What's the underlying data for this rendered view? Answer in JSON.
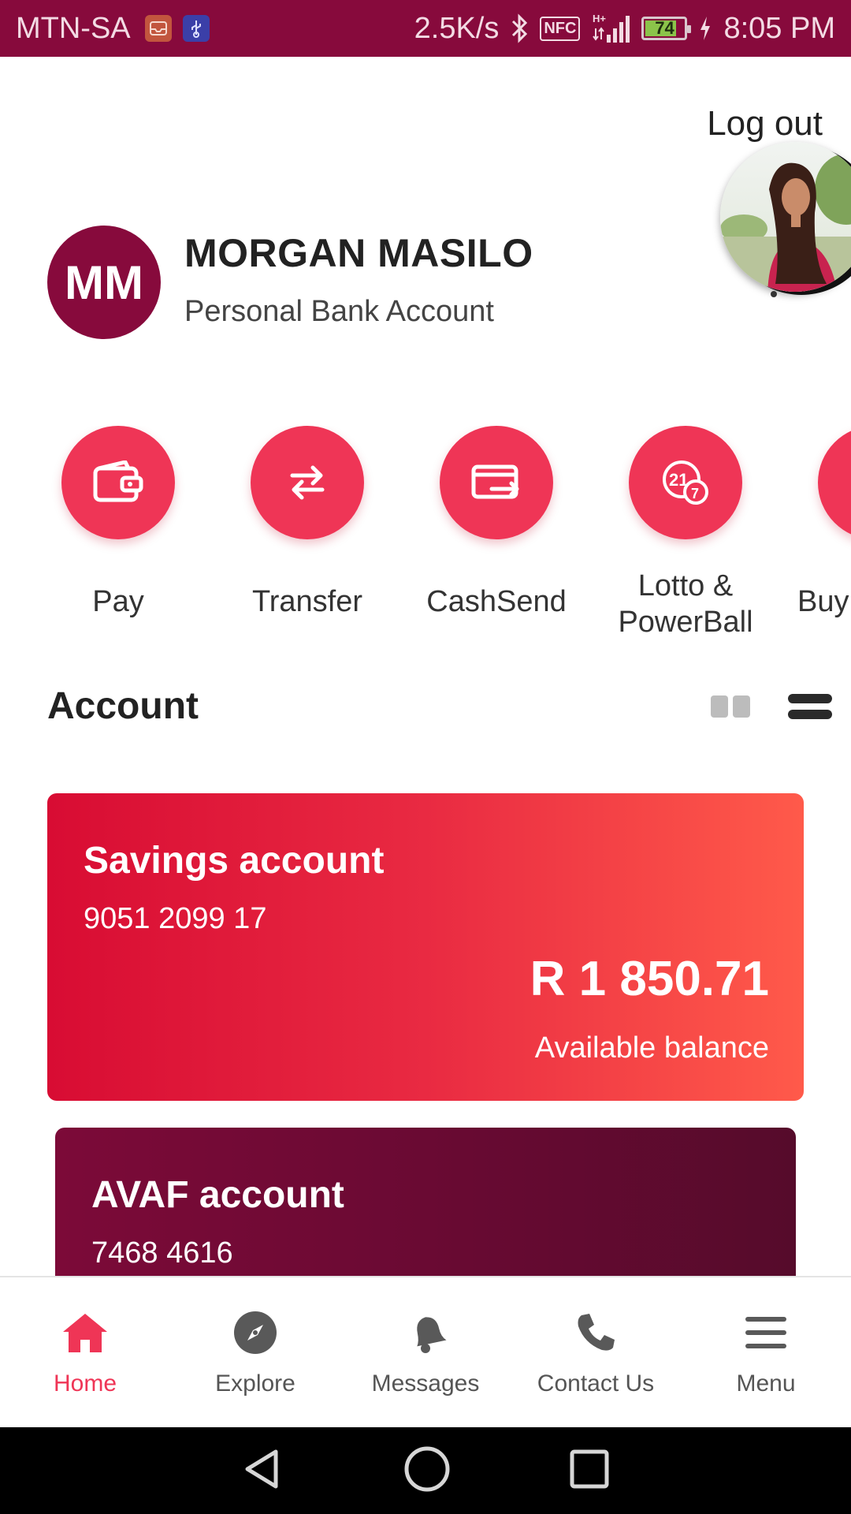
{
  "status_bar": {
    "carrier": "MTN-SA",
    "speed": "2.5K/s",
    "nfc": "NFC",
    "battery": "74",
    "time": "8:05 PM",
    "icons": [
      "gallery-app-icon",
      "usb-icon",
      "bluetooth-icon",
      "nfc-icon",
      "signal-icon",
      "battery-icon",
      "charging-icon"
    ]
  },
  "header": {
    "logout_label": "Log out",
    "avatar_initials": "MM",
    "user_name": "MORGAN MASILO",
    "account_type": "Personal Bank Account"
  },
  "actions": [
    {
      "label": "Pay",
      "icon": "wallet-icon"
    },
    {
      "label": "Transfer",
      "icon": "transfer-arrows-icon"
    },
    {
      "label": "CashSend",
      "icon": "cashsend-card-icon"
    },
    {
      "label": "Lotto & PowerBall",
      "line1": "Lotto &",
      "line2": "PowerBall",
      "icon": "lotto-balls-icon"
    },
    {
      "label": "Buy",
      "icon": "buy-icon"
    }
  ],
  "account_section": {
    "title": "Account"
  },
  "accounts": [
    {
      "name": "Savings account",
      "number": "9051 2099 17",
      "balance": "R 1 850.71",
      "balance_label": "Available balance"
    },
    {
      "name": "AVAF account",
      "number": "7468 4616"
    }
  ],
  "bottom_nav": [
    {
      "label": "Home",
      "icon": "home-icon",
      "active": true
    },
    {
      "label": "Explore",
      "icon": "compass-icon",
      "active": false
    },
    {
      "label": "Messages",
      "icon": "bell-icon",
      "active": false
    },
    {
      "label": "Contact Us",
      "icon": "phone-icon",
      "active": false
    },
    {
      "label": "Menu",
      "icon": "menu-icon",
      "active": false
    }
  ],
  "colors": {
    "brand": "#870a3c",
    "accent": "#ef3556",
    "savings_start": "#d80c33",
    "savings_end": "#ff5a4a",
    "avaf_start": "#7c0a38",
    "avaf_end": "#560b2b"
  }
}
